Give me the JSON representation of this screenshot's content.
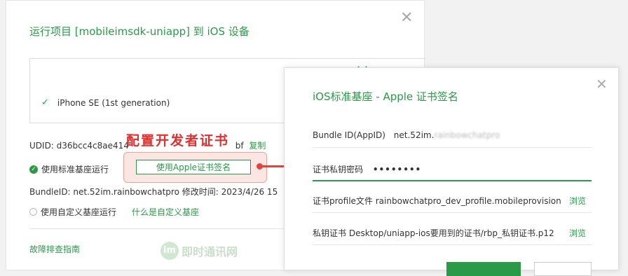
{
  "back_dialog": {
    "title": "运行项目 [mobileimsdk-uniapp] 到 iOS 设备",
    "close_glyph": "✕",
    "device": {
      "name": "iPhone SE (1st generation)"
    },
    "udid_text": "UDID: d36bcc4c8ae414",
    "udid_tail": "bf",
    "copy_label": "复制",
    "option_standard": "使用标准基座运行",
    "sign_button_label": "使用Apple证书签名",
    "bundle_text": "BundleID: net.52im.rainbowchatpro   修改时间: 2023/4/26 15",
    "option_custom": "使用自定义基座运行",
    "custom_link": "什么是自定义基座",
    "faq_link": "故障排查指南"
  },
  "annotation": {
    "text": "配置开发者证书",
    "color": "#e02f2f"
  },
  "watermark": {
    "logo": "im",
    "text": "即时通讯网"
  },
  "front_dialog": {
    "title": "iOS标准基座 - Apple 证书签名",
    "close_glyph": "✕",
    "bundle_label": "Bundle ID(AppID)",
    "bundle_value": "net.52im.",
    "bundle_blurred": "rainbowchatpro",
    "cert_pwd_label": "证书私钥密码",
    "cert_pwd_value": "••••••••",
    "profile_label": "证书profile文件",
    "profile_value": "rainbowchatpro_dev_profile.mobileprovision",
    "profile_action": "浏览",
    "key_label": "私钥证书",
    "key_value": "Desktop/uniapp-ios要用到的证书/rbp_私钥证书.p12",
    "key_action": "浏览"
  },
  "colors": {
    "accent": "#2a9a48",
    "arrow": "#e0453c"
  }
}
